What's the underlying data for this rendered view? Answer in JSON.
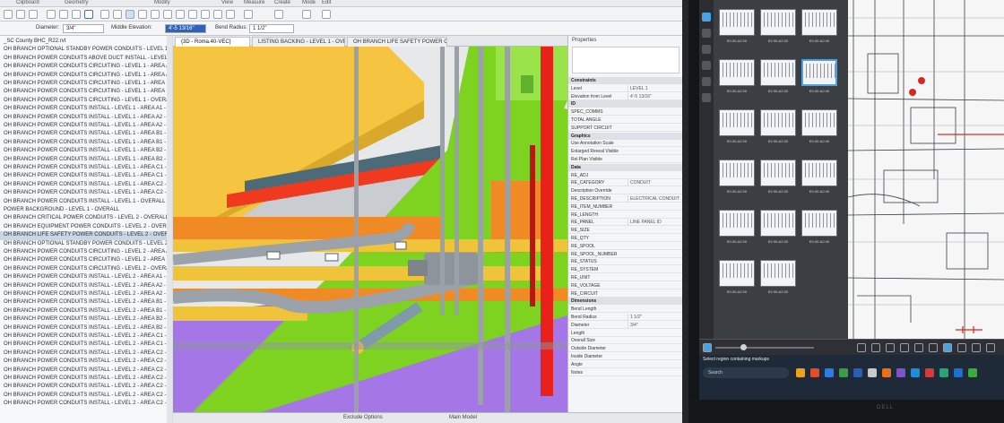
{
  "ribbon": {
    "groups": [
      "Clipboard",
      "Geometry",
      "Modify",
      "View",
      "Measure",
      "Create",
      "Mode",
      "Edit"
    ]
  },
  "options_bar": {
    "diameter_label": "Diameter:",
    "diameter_value": "3/4\"",
    "middle_elevation_label": "Middle Elevation:",
    "middle_elevation_value": "4'-5 13/16\"",
    "bend_radius_label": "Bend Radius:",
    "bend_radius_value": "1 1/2\""
  },
  "browser": {
    "rows": [
      "_SC County BHC_R22.rvt",
      "OH BRANCH OPTIONAL STANDBY POWER CONDUITS - LEVEL 1 - O",
      "OH BRANCH POWER CONDUITS ABOVE DUCT INSTALL - LEVEL 1 - O",
      "OH BRANCH POWER CONDUITS CIRCUITING - LEVEL 1 - AREA A2 - C",
      "OH BRANCH POWER CONDUITS CIRCUITING - LEVEL 1 - AREA A2 - C",
      "OH BRANCH POWER CONDUITS CIRCUITING - LEVEL 1 - AREA B1 - C",
      "OH BRANCH POWER CONDUITS CIRCUITING - LEVEL 1 - AREA B2 - C",
      "OH BRANCH POWER CONDUITS CIRCUITING - LEVEL 1 - OVERALL",
      "OH BRANCH POWER CONDUITS INSTALL - LEVEL 1 - AREA A1 - CAL",
      "OH BRANCH POWER CONDUITS INSTALL - LEVEL 1 - AREA A2 - CAL",
      "OH BRANCH POWER CONDUITS INSTALL - LEVEL 1 - AREA A2 - CAL",
      "OH BRANCH POWER CONDUITS INSTALL - LEVEL 1 - AREA B1 - CAL",
      "OH BRANCH POWER CONDUITS INSTALL - LEVEL 1 - AREA B1 - CAL",
      "OH BRANCH POWER CONDUITS INSTALL - LEVEL 1 - AREA B2 - CAL",
      "OH BRANCH POWER CONDUITS INSTALL - LEVEL 1 - AREA B2 - CAL",
      "OH BRANCH POWER CONDUITS INSTALL - LEVEL 1 - AREA C1 - CAL",
      "OH BRANCH POWER CONDUITS INSTALL - LEVEL 1 - AREA C1 - CAL",
      "OH BRANCH POWER CONDUITS INSTALL - LEVEL 1 - AREA C2 - CAL",
      "OH BRANCH POWER CONDUITS INSTALL - LEVEL 1 - AREA C2 - CAL",
      "OH BRANCH POWER CONDUITS INSTALL - LEVEL 1 - OVERALL",
      "POWER BACKGROUND - LEVEL 1 - OVERALL",
      "OH BRANCH CRITICAL POWER CONDUITS - LEVEL 2 - OVERALL",
      "OH BRANCH EQUIPMENT POWER CONDUITS - LEVEL 2 - OVERALL",
      "OH BRANCH LIFE SAFETY POWER CONDUITS - LEVEL 2 - OVERALL",
      "OH BRANCH OPTIONAL STANDBY POWER CONDUITS - LEVEL 2 - OV",
      "OH BRANCH POWER CONDUITS CIRCUITING - LEVEL 2 - AREA A2 - C",
      "OH BRANCH POWER CONDUITS CIRCUITING - LEVEL 2 - AREA B2 - C",
      "OH BRANCH POWER CONDUITS CIRCUITING - LEVEL 2 - OVERALL",
      "OH BRANCH POWER CONDUITS INSTALL - LEVEL 2 - AREA A1 - CAL",
      "OH BRANCH POWER CONDUITS INSTALL - LEVEL 2 - AREA A2 - CAL",
      "OH BRANCH POWER CONDUITS INSTALL - LEVEL 2 - AREA A2 - CAL",
      "OH BRANCH POWER CONDUITS INSTALL - LEVEL 2 - AREA B1 - CAL",
      "OH BRANCH POWER CONDUITS INSTALL - LEVEL 2 - AREA B1 - CAL",
      "OH BRANCH POWER CONDUITS INSTALL - LEVEL 2 - AREA B2 - CAL",
      "OH BRANCH POWER CONDUITS INSTALL - LEVEL 2 - AREA B2 - CAL",
      "OH BRANCH POWER CONDUITS INSTALL - LEVEL 2 - AREA C1 - CAL",
      "OH BRANCH POWER CONDUITS INSTALL - LEVEL 2 - AREA C1 - CAL",
      "OH BRANCH POWER CONDUITS INSTALL - LEVEL 2 - AREA C2 - CAL",
      "OH BRANCH POWER CONDUITS INSTALL - LEVEL 2 - AREA C2 - CAL",
      "OH BRANCH POWER CONDUITS INSTALL - LEVEL 2 - AREA C2 - CAL",
      "OH BRANCH POWER CONDUITS INSTALL - LEVEL 2 - AREA C2 - CAL",
      "OH BRANCH POWER CONDUITS INSTALL - LEVEL 2 - AREA C2 - CAL",
      "OH BRANCH POWER CONDUITS INSTALL - LEVEL 2 - AREA C2 - CAL",
      "OH BRANCH POWER CONDUITS INSTALL - LEVEL 2 - AREA C2 - CAL"
    ],
    "highlighted_index": 23
  },
  "view_tabs": [
    "{3D - Roma.40-VEC}",
    "LISTING BACKING - LEVEL 1 - OVE...",
    "OH BRANCH LIFE SAFETY POWER C..."
  ],
  "properties": {
    "title": "Properties",
    "rows": [
      {
        "type": "group",
        "label": "Constraints"
      },
      {
        "k": "Level",
        "v": "LEVEL 1"
      },
      {
        "k": "Elevation from Level",
        "v": "4'-5 13/16\""
      },
      {
        "type": "group",
        "label": "ID"
      },
      {
        "k": "SPEC_COMMS",
        "v": ""
      },
      {
        "k": "TOTAL ANGLE",
        "v": ""
      },
      {
        "k": "SUPPORT CIRCUIT",
        "v": ""
      },
      {
        "type": "group",
        "label": "Graphics"
      },
      {
        "k": "Use Annotation Scale",
        "v": ""
      },
      {
        "k": "Enlarged Reveal Visible",
        "v": ""
      },
      {
        "k": "Rel Plan Visible",
        "v": ""
      },
      {
        "type": "group",
        "label": "Data"
      },
      {
        "k": "RE_ADJ",
        "v": ""
      },
      {
        "k": "RE_CATEGORY",
        "v": "CONDUIT"
      },
      {
        "k": "Description Override",
        "v": ""
      },
      {
        "k": "RE_DESCRIPTION",
        "v": "ELECTRICAL CONDUIT"
      },
      {
        "k": "RE_ITEM_NUMBER",
        "v": ""
      },
      {
        "k": "RE_LENGTH",
        "v": ""
      },
      {
        "k": "RE_PANEL",
        "v": "LINE PANEL ID"
      },
      {
        "k": "RE_SIZE",
        "v": ""
      },
      {
        "k": "RE_QTY",
        "v": ""
      },
      {
        "k": "RE_SPOOL",
        "v": ""
      },
      {
        "k": "RE_SPOOL_NUMBER",
        "v": ""
      },
      {
        "k": "RE_STATUS",
        "v": ""
      },
      {
        "k": "RE_SYSTEM",
        "v": ""
      },
      {
        "k": "RE_UNIT",
        "v": ""
      },
      {
        "k": "RE_VOLTAGE",
        "v": ""
      },
      {
        "k": "RE_CIRCUIT",
        "v": ""
      },
      {
        "type": "group",
        "label": "Dimensions"
      },
      {
        "k": "Bend Length",
        "v": ""
      },
      {
        "k": "Bend Radius",
        "v": "1 1/2\""
      },
      {
        "k": "Diameter",
        "v": "3/4\""
      },
      {
        "k": "Length",
        "v": ""
      },
      {
        "k": "Overall Size",
        "v": ""
      },
      {
        "k": "Outside Diameter",
        "v": ""
      },
      {
        "k": "Inside Diameter",
        "v": ""
      },
      {
        "k": "Angle",
        "v": ""
      },
      {
        "k": "Notes",
        "v": ""
      }
    ]
  },
  "status_bar": {
    "exclude_options": "Exclude Options",
    "main_model": "Main Model"
  },
  "right_monitor": {
    "thumb_captions": [
      "E0.00-A2.00",
      "E0.00-A2.00",
      "E0.00-A2.00",
      "E0.00-A2.00",
      "E0.00-A2.00",
      "E0.00-A2.00",
      "E0.00-A2.00",
      "E0.00-A2.00",
      "E0.00-A2.00",
      "E0.00-A2.00",
      "E0.00-A2.00",
      "E0.00-A2.00",
      "E0.00-A2.00",
      "E0.00-A2.00",
      "E0.00-A2.00",
      "E0.00-A2.00",
      "E0.00-A2.00"
    ],
    "selected_thumb_index": 5,
    "notice": "Select region containing markups",
    "search_placeholder": "Search",
    "brand": "DELL"
  },
  "colors": {
    "yellow_duct": "#f5c542",
    "green_plane": "#7ed321",
    "orange_pipe": "#f08a24",
    "red_pipe": "#e8211a",
    "purple_floor": "#a476e6",
    "lime_panel": "#9be34a",
    "steel": "#9aa1a8",
    "thumb_select": "#4aa3e0"
  }
}
